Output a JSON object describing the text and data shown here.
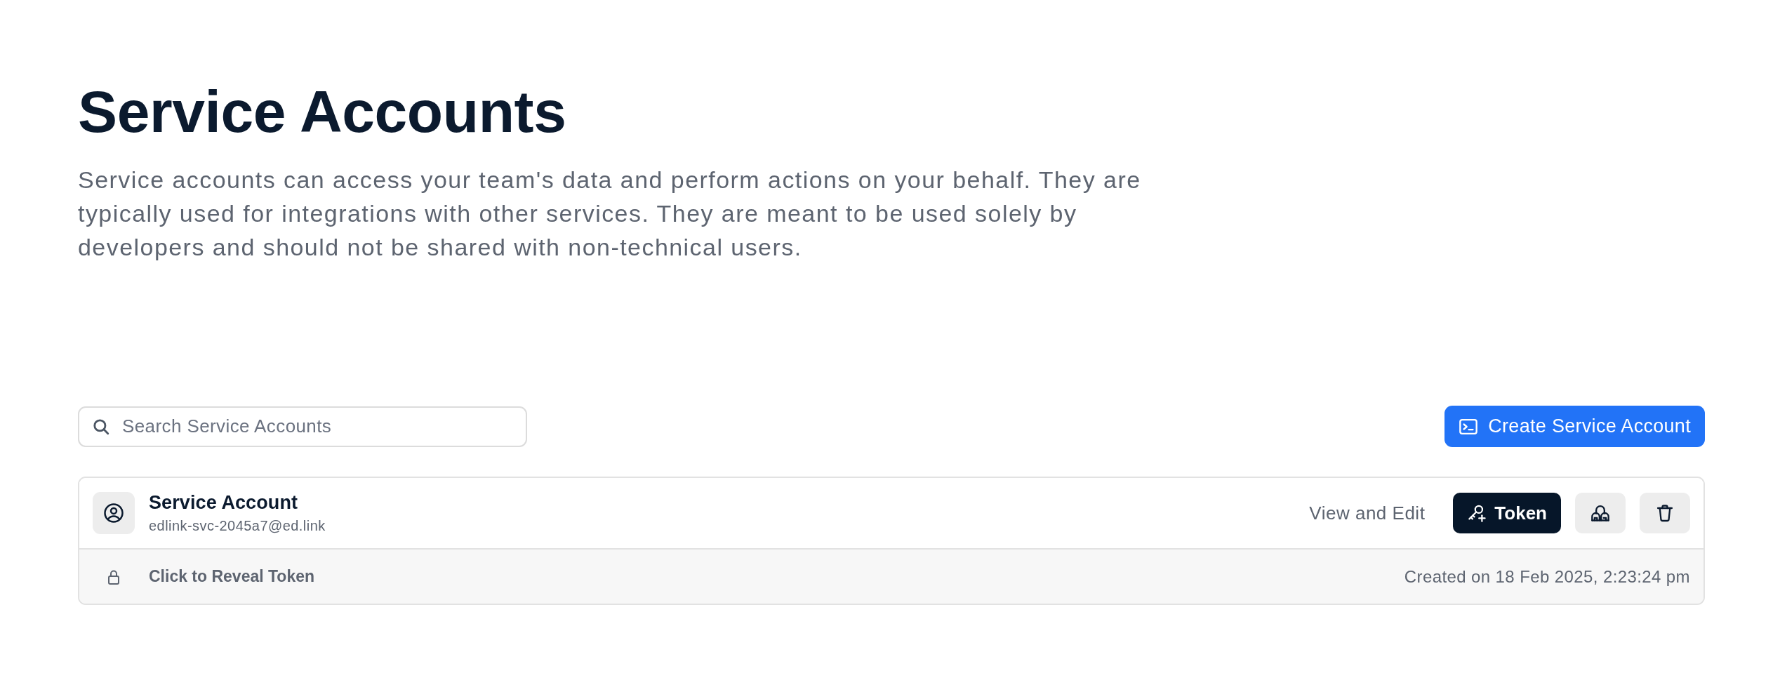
{
  "header": {
    "title": "Service Accounts",
    "description": "Service accounts can access your team's data and perform actions on your behalf. They are typically used for integrations with other services. They are meant to be used solely by developers and should not be shared with non-technical users."
  },
  "toolbar": {
    "search": {
      "placeholder": "Search Service Accounts"
    },
    "create_button": {
      "label": "Create Service Account"
    }
  },
  "accounts": [
    {
      "name": "Service Account",
      "email": "edlink-svc-2045a7@ed.link",
      "view_link": "View and Edit",
      "token_button": "Token",
      "reveal_token": "Click to Reveal Token",
      "created": "Created on 18 Feb 2025, 2:23:24 pm"
    }
  ]
}
